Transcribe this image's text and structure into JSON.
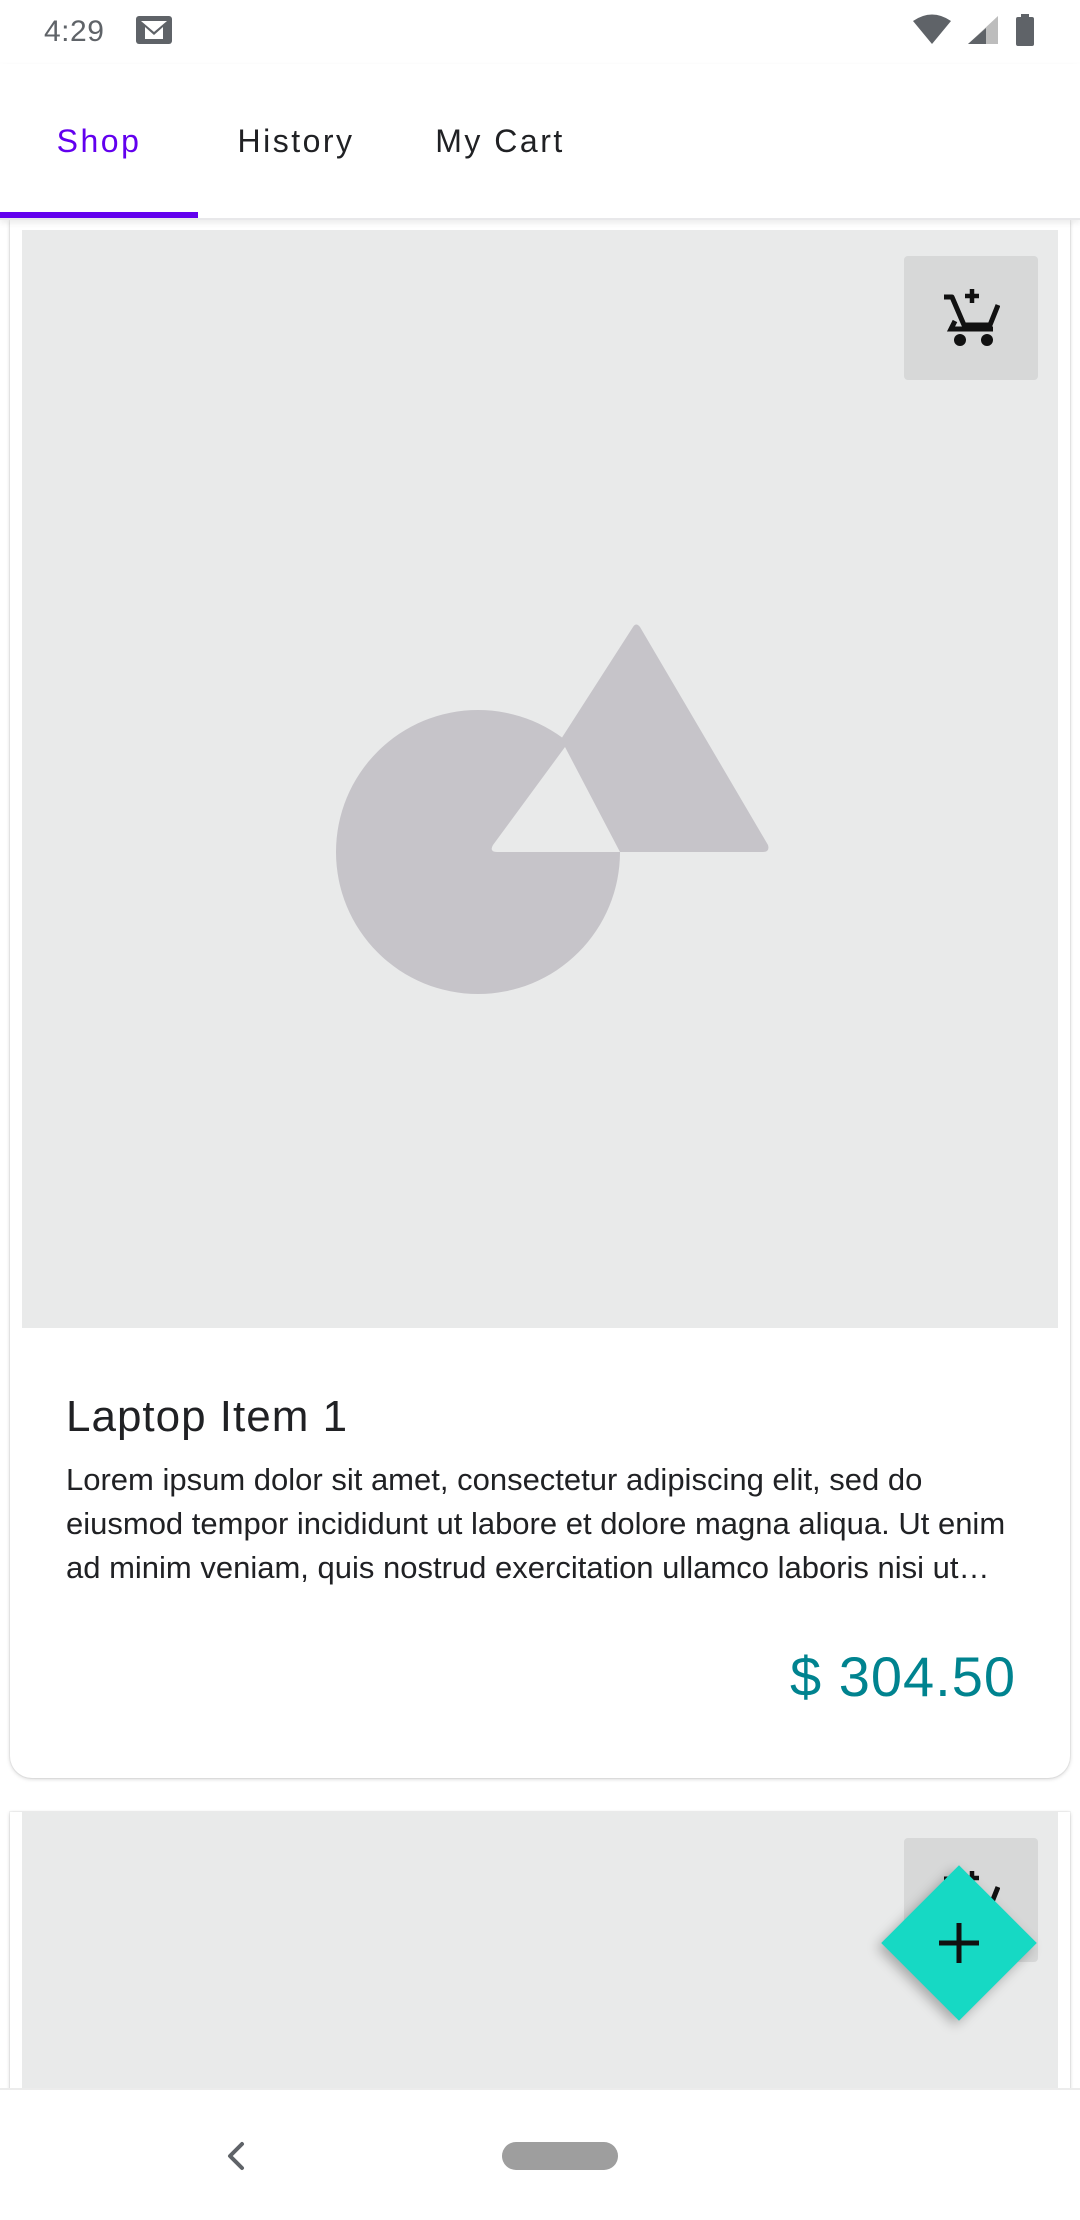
{
  "status_bar": {
    "time": "4:29",
    "icons": [
      "gmail-icon",
      "wifi-icon",
      "signal-icon",
      "battery-icon"
    ]
  },
  "tabs": [
    {
      "label": "Shop",
      "active": true
    },
    {
      "label": "History",
      "active": false
    },
    {
      "label": "My Cart",
      "active": false
    }
  ],
  "colors": {
    "accent": "#6200ee",
    "price": "#00838f",
    "fab": "#16d9c4",
    "media_bg": "#e9eaea",
    "placeholder_shape": "#c6c4c9"
  },
  "products": [
    {
      "title": "Laptop Item 1",
      "description": "Lorem ipsum dolor sit amet, consectetur adipiscing elit, sed do eiusmod tempor incididunt ut labore et dolore magna aliqua. Ut enim ad minim veniam, quis nostrud exercitation ullamco laboris nisi ut aliquip ex ea commodo consequat.",
      "price": "$ 304.50",
      "action_icon": "add-shopping-cart-icon"
    },
    {
      "action_icon": "add-shopping-cart-icon"
    }
  ],
  "fab": {
    "icon": "plus-icon"
  },
  "nav_bar": {
    "icons": [
      "back-icon",
      "home-pill"
    ]
  }
}
